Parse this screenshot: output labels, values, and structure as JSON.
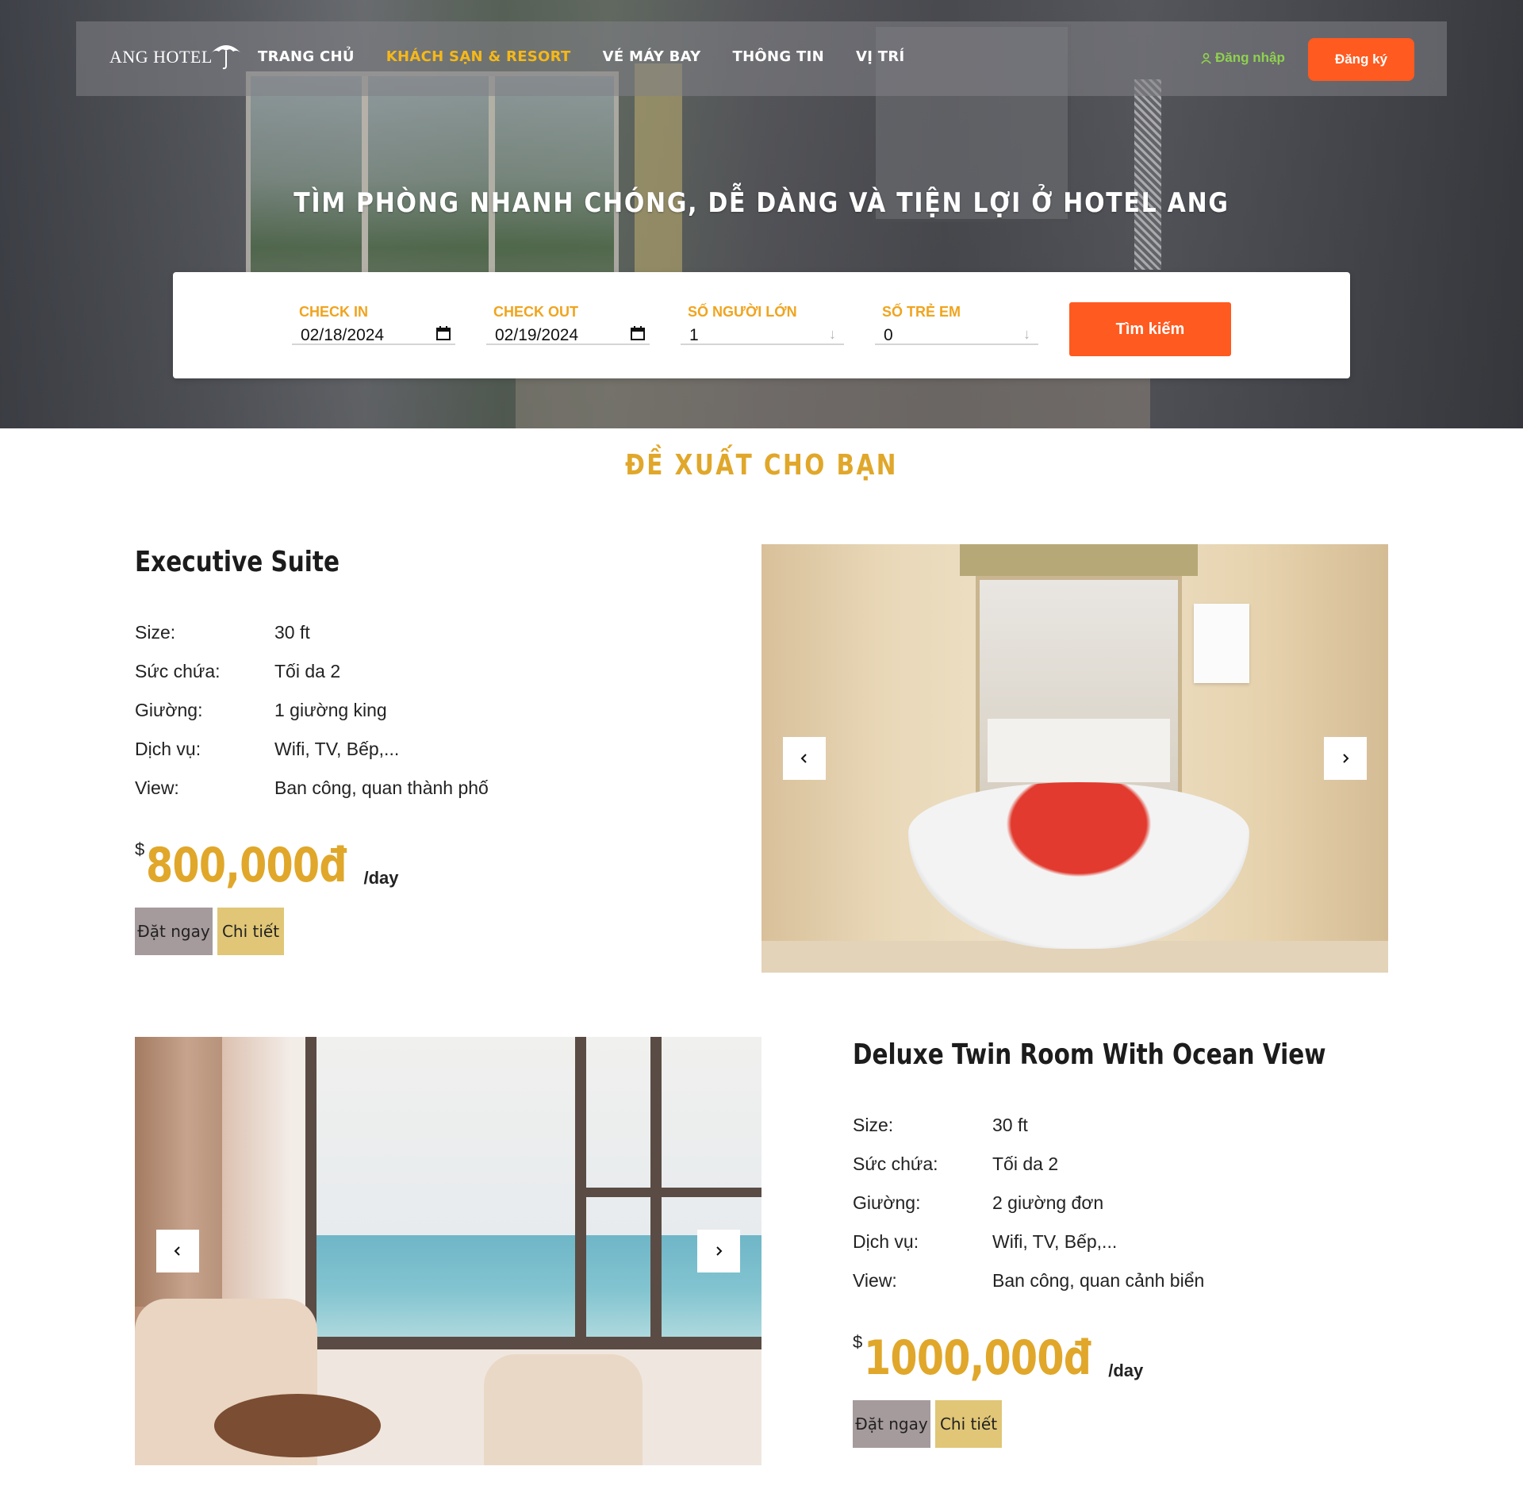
{
  "brand": {
    "logo_text": "ANG HOTEL",
    "logo_icon": "umbrella-icon"
  },
  "nav": {
    "links": [
      {
        "label": "TRANG CHỦ",
        "active": false
      },
      {
        "label": "KHÁCH SẠN & RESORT",
        "active": true
      },
      {
        "label": "VÉ MÁY BAY",
        "active": false
      },
      {
        "label": "THÔNG TIN",
        "active": false
      },
      {
        "label": "VỊ TRÍ",
        "active": false
      }
    ],
    "login_label": "Đăng nhập",
    "login_icon": "user-icon",
    "signup_label": "Đăng ký"
  },
  "hero": {
    "title": "TÌM PHÒNG NHANH CHÓNG, DỄ DÀNG VÀ TIỆN LỢI Ở HOTEL ANG"
  },
  "search": {
    "check_in_label": "CHECK IN",
    "check_in_value": "02/18/2024",
    "check_out_label": "CHECK OUT",
    "check_out_value": "02/19/2024",
    "adults_label": "SỐ NGƯỜI LỚN",
    "adults_value": "1",
    "children_label": "SỐ TRẺ EM",
    "children_value": "0",
    "button_label": "Tìm kiếm",
    "calendar_icon": "calendar-icon",
    "stepper_icon": "arrow-down-icon"
  },
  "section": {
    "title": "ĐỀ XUẤT CHO BẠN"
  },
  "rooms": [
    {
      "name": "Executive Suite",
      "specs": [
        {
          "k": "Size:",
          "v": "30 ft"
        },
        {
          "k": "Sức chứa:",
          "v": "Tối da 2"
        },
        {
          "k": "Giường:",
          "v": "1 giường king"
        },
        {
          "k": "Dịch vụ:",
          "v": "Wifi, TV, Bếp,..."
        },
        {
          "k": "View:",
          "v": "Ban công, quan thành phố"
        }
      ],
      "currency": "$",
      "price": "800,000đ",
      "per": "/day",
      "book_label": "Đặt ngay",
      "detail_label": "Chi tiết"
    },
    {
      "name": "Deluxe Twin Room With Ocean View",
      "specs": [
        {
          "k": "Size:",
          "v": "30 ft"
        },
        {
          "k": "Sức chứa:",
          "v": "Tối da 2"
        },
        {
          "k": "Giường:",
          "v": "2 giường đơn"
        },
        {
          "k": "Dịch vụ:",
          "v": "Wifi, TV, Bếp,..."
        },
        {
          "k": "View:",
          "v": "Ban công, quan cảnh biển"
        }
      ],
      "currency": "$",
      "price": "1000,000đ",
      "per": "/day",
      "book_label": "Đặt ngay",
      "detail_label": "Chi tiết"
    }
  ],
  "colors": {
    "accent_orange": "#ff5a1f",
    "gold": "#e0a72a",
    "nav_active": "#f6b818",
    "login_green": "#8fd14f",
    "book_button": "#a59a9c",
    "detail_button": "#e0c676"
  }
}
